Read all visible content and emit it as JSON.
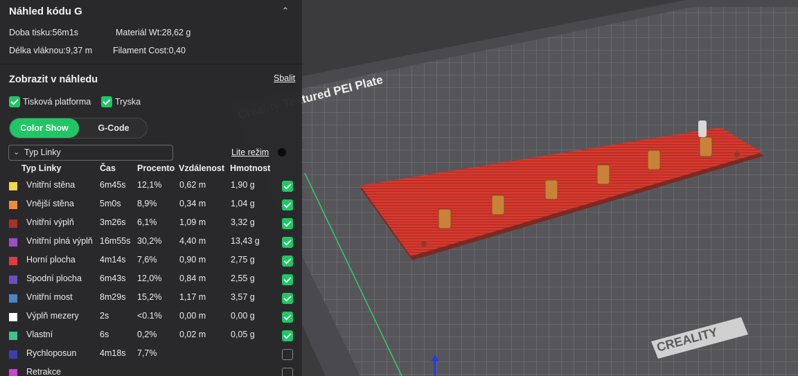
{
  "panel": {
    "title": "Náhled kódu G",
    "stats": {
      "print_time": "Doba tisku:56m1s",
      "material": "Materiál Wt:28,62 g",
      "filament_length": "Délka vláknou:9,37 m",
      "filament_cost": "Filament Cost:0,40"
    },
    "section_title": "Zobrazit v náhledu",
    "collapse_label": "Sbalit",
    "checkbox_bed": "Tisková platforma",
    "checkbox_nozzle": "Tryska",
    "tab_color_show": "Color Show",
    "tab_gcode": "G-Code",
    "dropdown_value": "Typ Linky",
    "lite_mode": "Lite režim",
    "columns": [
      "Typ Linky",
      "Čas",
      "Procento",
      "Vzdálenost",
      "Hmotnost"
    ],
    "rows": [
      {
        "name": "Vnitřní stěna",
        "time": "6m45s",
        "pct": "12,1%",
        "dist": "0,62 m",
        "weight": "1,90 g",
        "color": "#f4d84a",
        "checked": true
      },
      {
        "name": "Vnější stěna",
        "time": "5m0s",
        "pct": "8,9%",
        "dist": "0,34 m",
        "weight": "1,04 g",
        "color": "#f08a3c",
        "checked": true
      },
      {
        "name": "Vnitřní výplň",
        "time": "3m26s",
        "pct": "6,1%",
        "dist": "1,09 m",
        "weight": "3,32 g",
        "color": "#a6302c",
        "checked": true
      },
      {
        "name": "Vnitřní plná výplň",
        "time": "16m55s",
        "pct": "30,2%",
        "dist": "4,40 m",
        "weight": "13,43 g",
        "color": "#9b4fc4",
        "checked": true
      },
      {
        "name": "Horní plocha",
        "time": "4m14s",
        "pct": "7,6%",
        "dist": "0,90 m",
        "weight": "2,75 g",
        "color": "#e23b3b",
        "checked": true
      },
      {
        "name": "Spodní plocha",
        "time": "6m43s",
        "pct": "12,0%",
        "dist": "0,84 m",
        "weight": "2,55 g",
        "color": "#6a4fc4",
        "checked": true
      },
      {
        "name": "Vnitřní most",
        "time": "8m29s",
        "pct": "15,2%",
        "dist": "1,17 m",
        "weight": "3,57 g",
        "color": "#4a86c4",
        "checked": true
      },
      {
        "name": "Výplň mezery",
        "time": "2s",
        "pct": "<0.1%",
        "dist": "0,00 m",
        "weight": "0,00 g",
        "color": "#ffffff",
        "checked": true
      },
      {
        "name": "Vlastní",
        "time": "6s",
        "pct": "0,2%",
        "dist": "0,02 m",
        "weight": "0,05 g",
        "color": "#3fc48a",
        "checked": true
      },
      {
        "name": "Rychloposun",
        "time": "4m18s",
        "pct": "7,7%",
        "dist": "",
        "weight": "",
        "color": "#3a3fb0",
        "checked": false
      },
      {
        "name": "Retrakce",
        "time": "",
        "pct": "",
        "dist": "",
        "weight": "",
        "color": "#d23fd6",
        "checked": false
      }
    ]
  },
  "viewport": {
    "plate_label": "Creality Textured PEI Plate",
    "brand_logo": "CREALITY",
    "part_color": "#d63a2e",
    "accent": "#1ec763"
  }
}
